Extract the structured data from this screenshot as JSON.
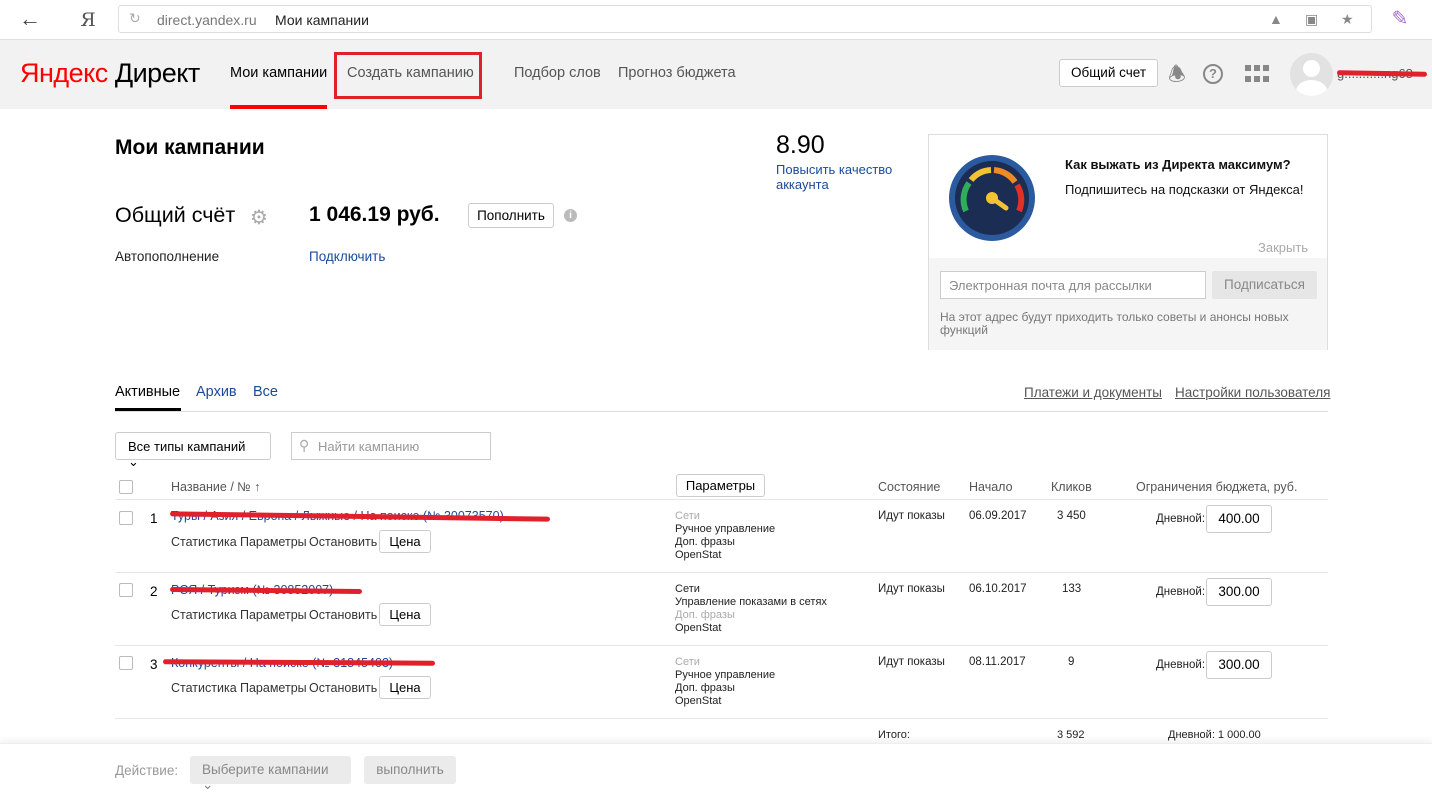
{
  "browser": {
    "back_icon": "arrow-left-icon",
    "ya_button": "Я",
    "url_domain": "direct.yandex.ru",
    "page_title": "Мои кампании"
  },
  "header": {
    "logo_ya": "Яндекс",
    "logo_direct": "Директ",
    "nav": {
      "my_campaigns": "Мои кампании",
      "create_campaign": "Создать кампанию",
      "word_selection": "Подбор слов",
      "budget_forecast": "Прогноз бюджета"
    },
    "account_button": "Общий счет",
    "username": "g...........ng68",
    "accent_color": "#ff0000",
    "highlight_color": "#e0202a"
  },
  "main": {
    "title": "Мои кампании",
    "account_label": "Общий счёт",
    "balance": "1 046.19 руб.",
    "topup_button": "Пополнить",
    "autopay_label": "Автопополнение",
    "autopay_link": "Подключить",
    "quality_score": "8.90",
    "quality_link": "Повысить качество аккаунта"
  },
  "promo": {
    "title": "Как выжать из Директа максимум?",
    "subtitle": "Подпишитесь на подсказки от Яндекса!",
    "close": "Закрыть",
    "email_placeholder": "Электронная почта для рассылки",
    "subscribe_button": "Подписаться",
    "note": "На этот адрес будут приходить только советы и анонсы новых функций"
  },
  "tabs": {
    "active": "Активные",
    "archive": "Архив",
    "all": "Все",
    "payments_link": "Платежи и документы",
    "user_settings_link": "Настройки пользователя"
  },
  "filters": {
    "type_select": "Все типы кампаний",
    "search_placeholder": "Найти кампанию"
  },
  "table": {
    "headers": {
      "name": "Название / № ↑",
      "params_button": "Параметры",
      "state": "Состояние",
      "start": "Начало",
      "clicks": "Кликов",
      "budget": "Ограничения бюджета, руб."
    },
    "rows": [
      {
        "num": "1",
        "name": "Туры / Азия / Европа / Лыжные / На поиске (№ 30073570)",
        "links": [
          "Статистика",
          "Параметры",
          "Остановить"
        ],
        "price_button": "Цена",
        "strategy": [
          "Сети",
          "Ручное управление",
          "Доп. фразы",
          "OpenStat"
        ],
        "strategy_dim": [
          true,
          false,
          false,
          false
        ],
        "state": "Идут показы",
        "start": "06.09.2017",
        "clicks": "3 450",
        "limit_label": "Дневной:",
        "limit_value": "400.00"
      },
      {
        "num": "2",
        "name": "РСЯ / Туризм (№ 30852007)",
        "links": [
          "Статистика",
          "Параметры",
          "Остановить"
        ],
        "price_button": "Цена",
        "strategy": [
          "Сети",
          "Управление показами в сетях",
          "Доп. фразы",
          "OpenStat"
        ],
        "strategy_dim": [
          false,
          false,
          true,
          false
        ],
        "state": "Идут показы",
        "start": "06.10.2017",
        "clicks": "133",
        "limit_label": "Дневной:",
        "limit_value": "300.00"
      },
      {
        "num": "3",
        "name": "Конкуренты / На поиске (№ 31845403)",
        "links": [
          "Статистика",
          "Параметры",
          "Остановить"
        ],
        "price_button": "Цена",
        "strategy": [
          "Сети",
          "Ручное управление",
          "Доп. фразы",
          "OpenStat"
        ],
        "strategy_dim": [
          true,
          false,
          false,
          false
        ],
        "state": "Идут показы",
        "start": "08.11.2017",
        "clicks": "9",
        "limit_label": "Дневной:",
        "limit_value": "300.00"
      }
    ],
    "totals": {
      "label": "Итого:",
      "clicks": "3 592",
      "budget": "Дневной: 1 000.00"
    }
  },
  "action_bar": {
    "label": "Действие:",
    "select": "Выберите кампании",
    "execute": "выполнить"
  }
}
